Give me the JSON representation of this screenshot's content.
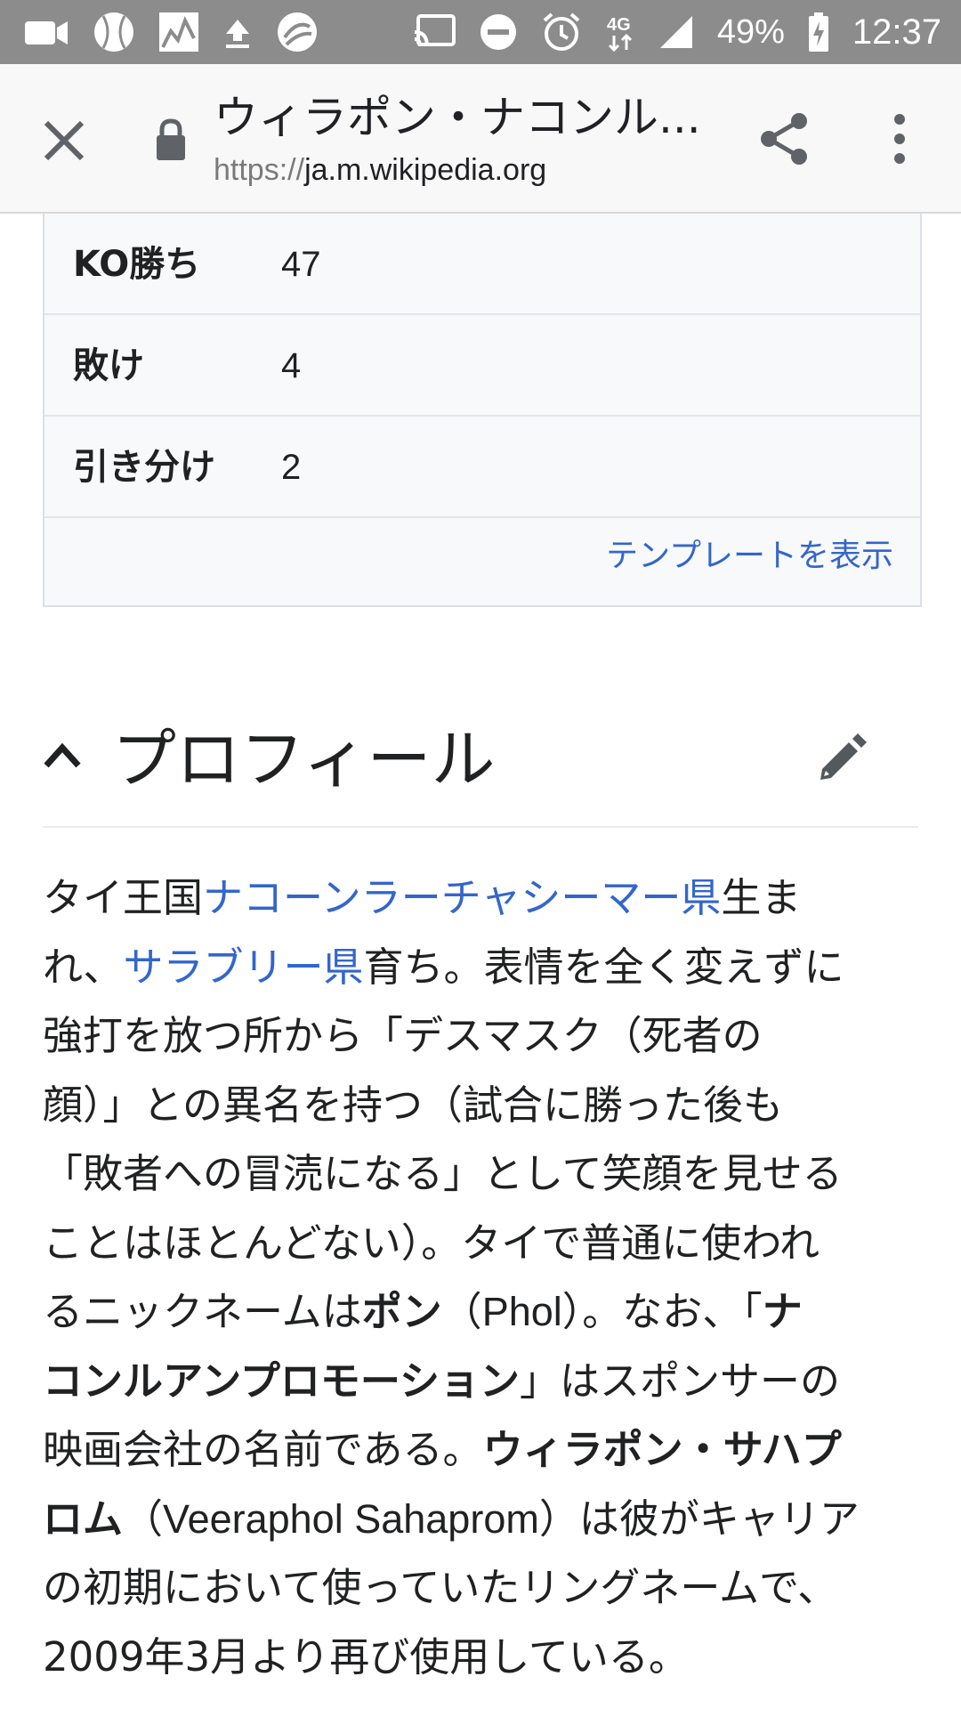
{
  "status_bar": {
    "battery": "49%",
    "time": "12:37",
    "left_icons": [
      "video-icon",
      "baseball-icon",
      "stock-chart-icon",
      "upload-icon",
      "app-swirl-icon"
    ],
    "right_icons": [
      "cast-icon",
      "do-not-disturb-icon",
      "alarm-icon",
      "4g-data-icon",
      "signal-icon",
      "battery-icon"
    ]
  },
  "toolbar": {
    "title": "ウィラポン・ナコンル...",
    "url_scheme": "https://",
    "url_host": "ja.m.wikipedia.org"
  },
  "infobox": {
    "rows": [
      {
        "label": "KO勝ち",
        "value": "47"
      },
      {
        "label": "敗け",
        "value": "4"
      },
      {
        "label": "引き分け",
        "value": "2"
      }
    ],
    "template_link": "テンプレートを表示"
  },
  "section": {
    "title": "プロフィール"
  },
  "paragraph": {
    "l1a": "タイ王国",
    "l1b": "ナコーンラーチャシーマー県",
    "l1c": "生ま",
    "l2a": "れ、",
    "l2b": "サラブリー県",
    "l2c": "育ち。表情を全く変えずに",
    "l3": "強打を放つ所から「デスマスク（死者の",
    "l4": "顔）」との異名を持つ（試合に勝った後も",
    "l5": "「敗者への冒涜になる」として笑顔を見せる",
    "l6": "ことはほとんどない）。タイで普通に使われ",
    "l7a": "るニックネームは",
    "l7b": "ポン",
    "l7c": "（",
    "l7d": "Phol",
    "l7e": "）。なお、「",
    "l7f": "ナ",
    "l8a": "コンルアンプロモーション",
    "l8b": "」はスポンサーの",
    "l9a": "映画会社の名前である。",
    "l9b": "ウィラポン・サハプ",
    "l10a": "ロム",
    "l10b": "（",
    "l10c": "Veeraphol Sahaprom",
    "l10d": "）は彼がキャリア",
    "l11": "の初期において使っていたリングネームで、",
    "l12": "2009年3月より再び使用している。"
  }
}
